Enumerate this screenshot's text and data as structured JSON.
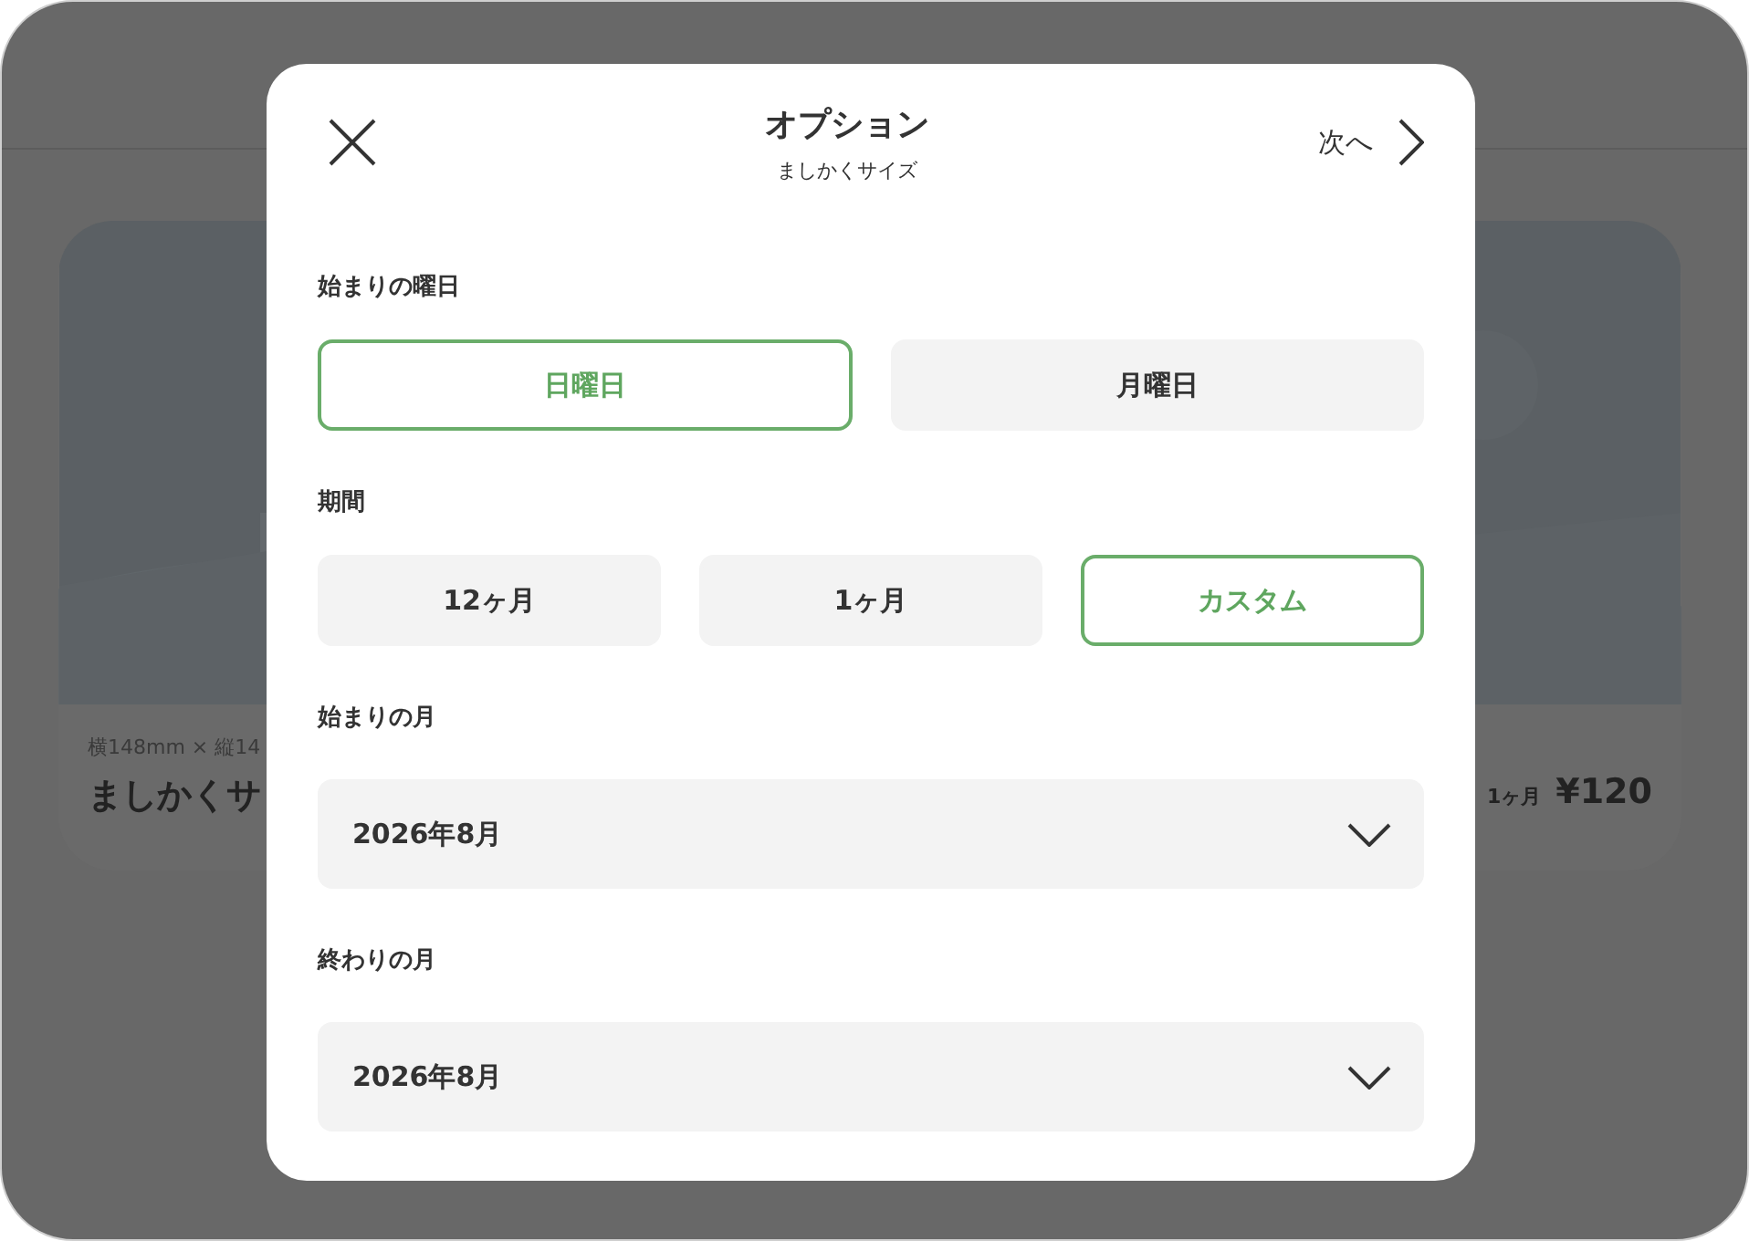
{
  "card": {
    "kind": "picture",
    "dimensions": "横148mm × 縦14",
    "name": "ましかくサ",
    "period": "1ヶ月",
    "price": "¥120"
  },
  "dialog": {
    "title": "オプション",
    "subtitle": "ましかくサイズ",
    "next_label": "次へ",
    "sections": [
      {
        "label": "始まりの曜日",
        "kind": "choices",
        "options": [
          {
            "label": "日曜日",
            "selected": true
          },
          {
            "label": "月曜日",
            "selected": false
          }
        ]
      },
      {
        "label": "期間",
        "kind": "choices",
        "options": [
          {
            "label": "12ヶ月",
            "selected": false
          },
          {
            "label": "1ヶ月",
            "selected": false
          },
          {
            "label": "カスタム",
            "selected": true
          }
        ]
      },
      {
        "label": "始まりの月",
        "kind": "select",
        "value": "2026年8月"
      },
      {
        "label": "終わりの月",
        "kind": "select",
        "value": "2026年8月"
      }
    ]
  }
}
